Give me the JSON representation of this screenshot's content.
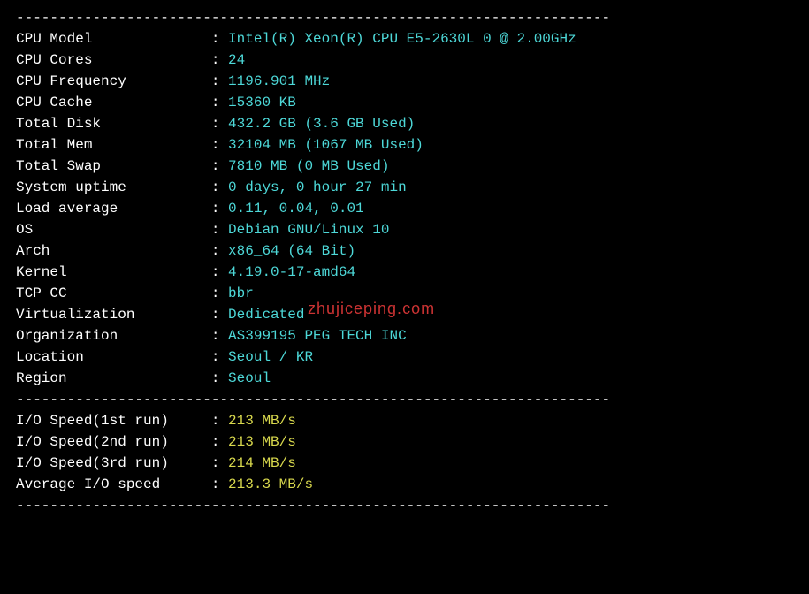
{
  "divider": "----------------------------------------------------------------------",
  "sysinfo": [
    {
      "label": "CPU Model",
      "value": "Intel(R) Xeon(R) CPU E5-2630L 0 @ 2.00GHz"
    },
    {
      "label": "CPU Cores",
      "value": "24"
    },
    {
      "label": "CPU Frequency",
      "value": "1196.901 MHz"
    },
    {
      "label": "CPU Cache",
      "value": "15360 KB"
    },
    {
      "label": "Total Disk",
      "value": "432.2 GB (3.6 GB Used)"
    },
    {
      "label": "Total Mem",
      "value": "32104 MB (1067 MB Used)"
    },
    {
      "label": "Total Swap",
      "value": "7810 MB (0 MB Used)"
    },
    {
      "label": "System uptime",
      "value": "0 days, 0 hour 27 min"
    },
    {
      "label": "Load average",
      "value": "0.11, 0.04, 0.01"
    },
    {
      "label": "OS",
      "value": "Debian GNU/Linux 10"
    },
    {
      "label": "Arch",
      "value": "x86_64 (64 Bit)"
    },
    {
      "label": "Kernel",
      "value": "4.19.0-17-amd64"
    },
    {
      "label": "TCP CC",
      "value": "bbr"
    },
    {
      "label": "Virtualization",
      "value": "Dedicated"
    },
    {
      "label": "Organization",
      "value": "AS399195 PEG TECH INC"
    },
    {
      "label": "Location",
      "value": "Seoul / KR"
    },
    {
      "label": "Region",
      "value": "Seoul"
    }
  ],
  "iospeed": [
    {
      "label": "I/O Speed(1st run)",
      "value": "213 MB/s"
    },
    {
      "label": "I/O Speed(2nd run)",
      "value": "213 MB/s"
    },
    {
      "label": "I/O Speed(3rd run)",
      "value": "214 MB/s"
    },
    {
      "label": "Average I/O speed",
      "value": "213.3 MB/s"
    }
  ],
  "watermark": "zhujiceping.com"
}
